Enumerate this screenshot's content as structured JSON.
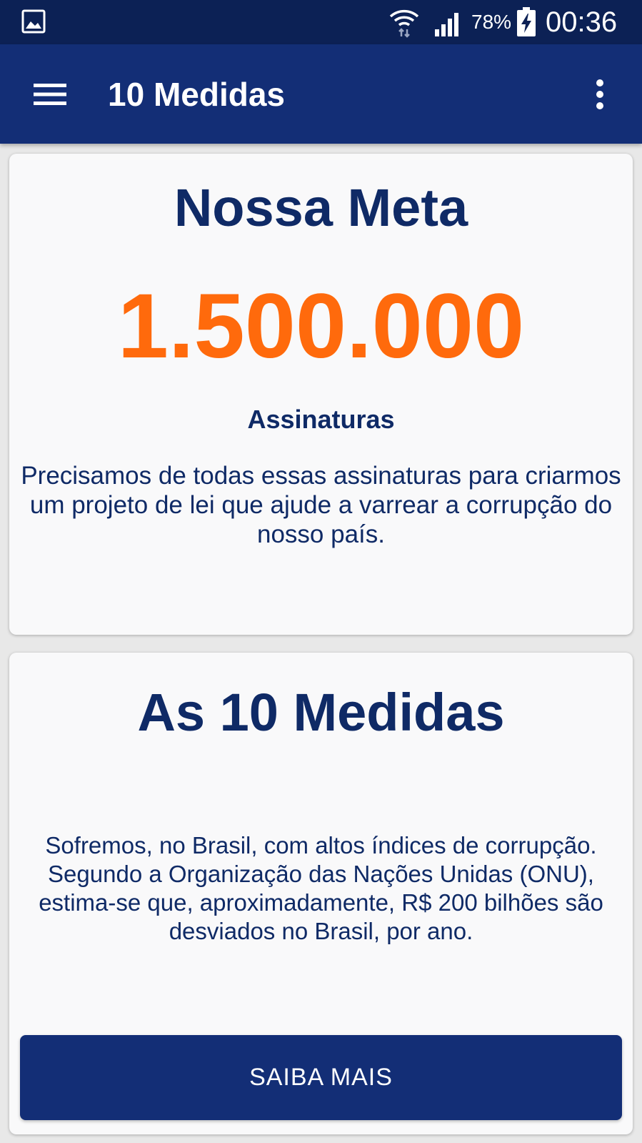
{
  "status_bar": {
    "left_icon": "gallery-icon",
    "wifi_icon": "wifi-icon",
    "signal_icon": "signal-icon",
    "battery_percent": "78%",
    "battery_icon": "battery-charging-icon",
    "time": "00:36"
  },
  "app_bar": {
    "menu_icon": "hamburger-menu-icon",
    "title": "10 Medidas",
    "overflow_icon": "more-vertical-icon"
  },
  "goal_card": {
    "title": "Nossa Meta",
    "goal_number": "1.500.000",
    "goal_unit": "Assinaturas",
    "description": "Precisamos de todas essas assinaturas para criarmos um projeto de lei que ajude a varrear a corrupção do nosso país."
  },
  "measures_card": {
    "title": "As 10 Medidas",
    "description": "Sofremos, no Brasil, com altos índices de corrupção. Segundo a Organização das Nações Unidas (ONU), estima-se que, aproximadamente, R$ 200 bilhões são desviados no Brasil, por ano.",
    "button_label": "SAIBA MAIS"
  },
  "colors": {
    "status_bar": "#0c2155",
    "app_bar": "#132e76",
    "primary_text": "#0f2a66",
    "accent": "#ff6a0c",
    "card_background": "#f9f9fa"
  }
}
